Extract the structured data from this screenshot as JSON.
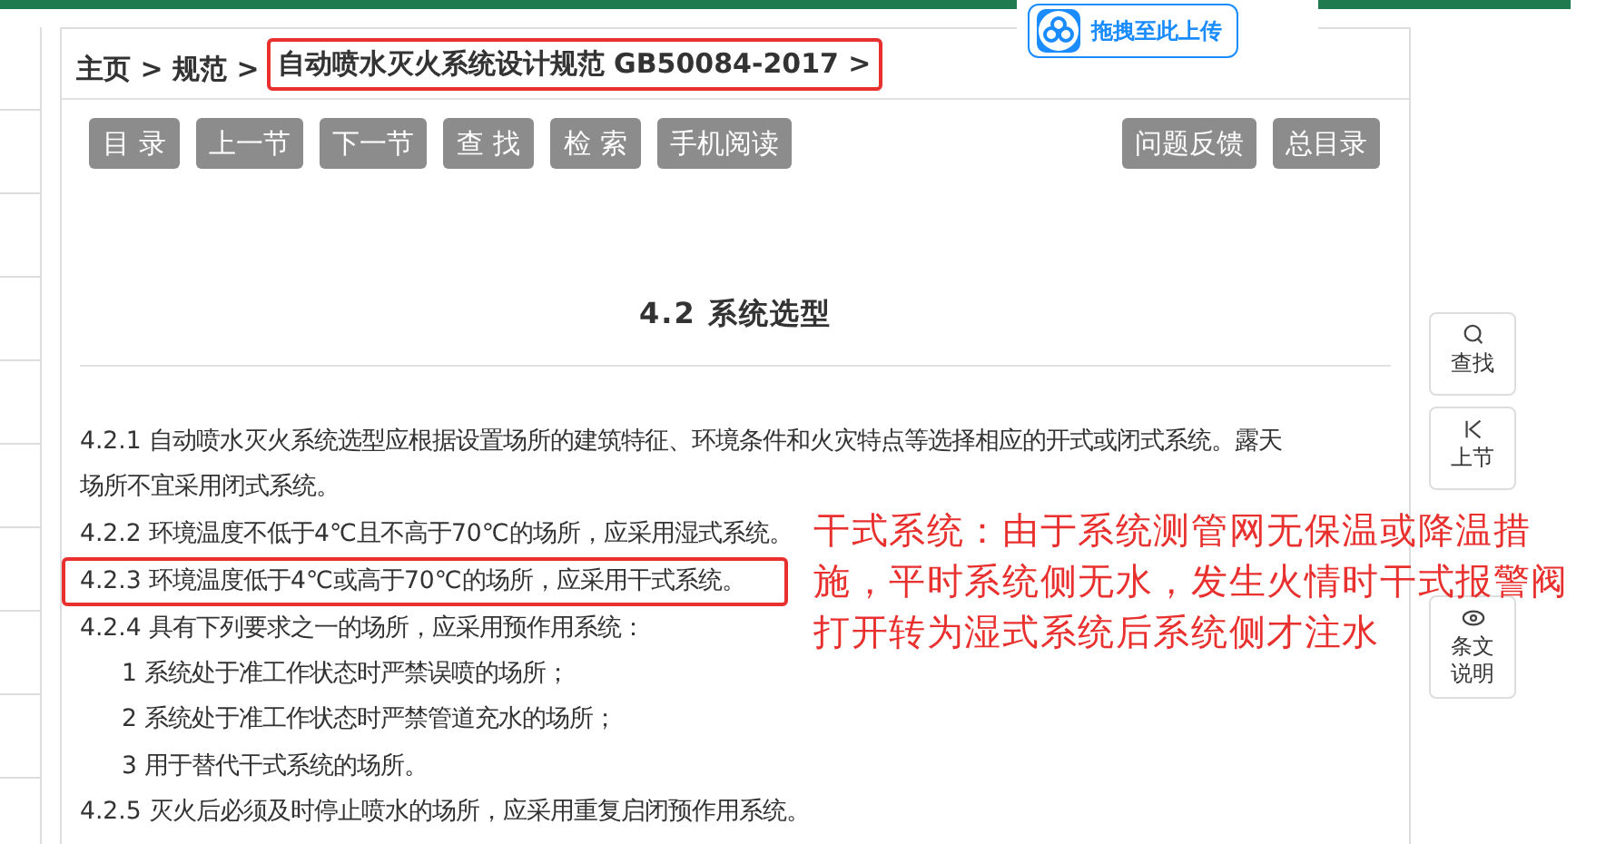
{
  "upload_button": {
    "label": "拖拽至此上传"
  },
  "breadcrumb": {
    "plain": "主页 > 规范 >",
    "highlighted": "自动喷水灭火系统设计规范 GB50084-2017 >"
  },
  "toolbar": {
    "left": [
      "目 录",
      "上一节",
      "下一节",
      "查 找",
      "检 索",
      "手机阅读"
    ],
    "right": [
      "问题反馈",
      "总目录"
    ]
  },
  "heading": "4.2 系统选型",
  "clauses": [
    {
      "kind": "clause",
      "highlighted": false,
      "text": "4.2.1 自动喷水灭火系统选型应根据设置场所的建筑特征、环境条件和火灾特点等选择相应的开式或闭式系统。露天场所不宜采用闭式系统。"
    },
    {
      "kind": "clause",
      "highlighted": false,
      "text": "4.2.2 环境温度不低于4℃且不高于70℃的场所，应采用湿式系统。"
    },
    {
      "kind": "clause",
      "highlighted": true,
      "text": "4.2.3 环境温度低于4℃或高于70℃的场所，应采用干式系统。"
    },
    {
      "kind": "clause",
      "highlighted": false,
      "text": "4.2.4 具有下列要求之一的场所，应采用预作用系统："
    },
    {
      "kind": "item",
      "highlighted": false,
      "text": "1 系统处于准工作状态时严禁误喷的场所；"
    },
    {
      "kind": "item",
      "highlighted": false,
      "text": "2 系统处于准工作状态时严禁管道充水的场所；"
    },
    {
      "kind": "item",
      "highlighted": false,
      "text": "3 用于替代干式系统的场所。"
    },
    {
      "kind": "clause",
      "highlighted": false,
      "text": "4.2.5 灭火后必须及时停止喷水的场所，应采用重复启闭预作用系统。"
    }
  ],
  "annotation": [
    "干式系统：由于系统测管网无保温或降温措",
    "施，平时系统侧无水，发生火情时干式报警阀",
    "打开转为湿式系统后系统侧才注水"
  ],
  "side_tools": [
    {
      "kind": "search",
      "label": "查找"
    },
    {
      "kind": "previous",
      "label": "上节"
    },
    {
      "kind": "covered"
    },
    {
      "kind": "explain",
      "label": "条文说明"
    }
  ]
}
